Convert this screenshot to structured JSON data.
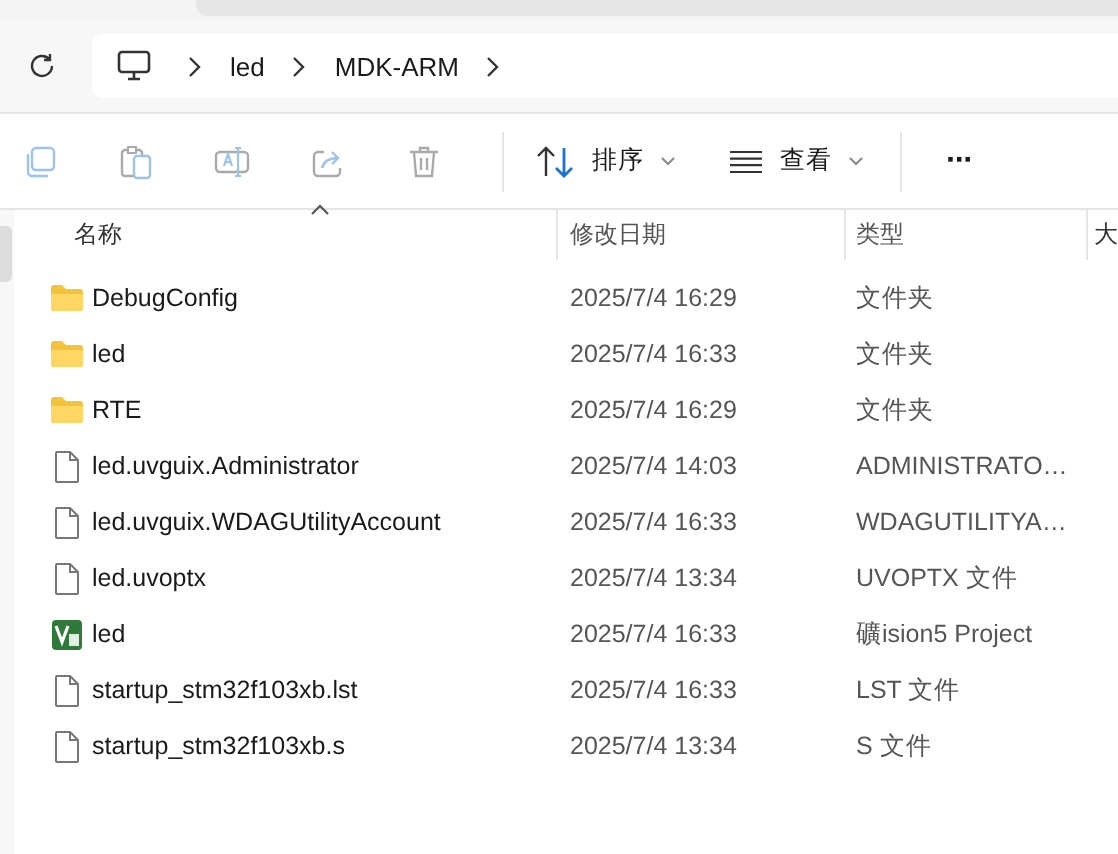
{
  "address_bar": {
    "segments": [
      {
        "kind": "computer"
      },
      {
        "kind": "text",
        "label": "led"
      },
      {
        "kind": "text",
        "label": "MDK-ARM"
      }
    ]
  },
  "toolbar": {
    "actions": [
      {
        "kind": "copy",
        "disabled": true
      },
      {
        "kind": "paste",
        "disabled": true
      },
      {
        "kind": "rename",
        "disabled": true
      },
      {
        "kind": "share",
        "disabled": true
      },
      {
        "kind": "delete",
        "disabled": true
      }
    ],
    "sort": {
      "label": "排序"
    },
    "view": {
      "label": "查看"
    },
    "more": {
      "label": "···"
    }
  },
  "table": {
    "columns": [
      {
        "label": "名称",
        "sorted": true
      },
      {
        "label": "修改日期",
        "sorted": false
      },
      {
        "label": "类型",
        "sorted": false
      },
      {
        "label": "大",
        "sorted": false
      }
    ],
    "rows": [
      {
        "kind": "folder",
        "name": "DebugConfig",
        "modified": "2025/7/4 16:29",
        "type": "文件夹"
      },
      {
        "kind": "folder",
        "name": "led",
        "modified": "2025/7/4 16:33",
        "type": "文件夹"
      },
      {
        "kind": "folder",
        "name": "RTE",
        "modified": "2025/7/4 16:29",
        "type": "文件夹"
      },
      {
        "kind": "file",
        "name": "led.uvguix.Administrator",
        "modified": "2025/7/4 14:03",
        "type": "ADMINISTRATO…"
      },
      {
        "kind": "file",
        "name": "led.uvguix.WDAGUtilityAccount",
        "modified": "2025/7/4 16:33",
        "type": "WDAGUTILITYA…"
      },
      {
        "kind": "file",
        "name": "led.uvoptx",
        "modified": "2025/7/4 13:34",
        "type": "UVOPTX 文件"
      },
      {
        "kind": "project",
        "name": "led",
        "modified": "2025/7/4 16:33",
        "type": "礦ision5 Project"
      },
      {
        "kind": "file",
        "name": "startup_stm32f103xb.lst",
        "modified": "2025/7/4 16:33",
        "type": "LST 文件"
      },
      {
        "kind": "file",
        "name": "startup_stm32f103xb.s",
        "modified": "2025/7/4 13:34",
        "type": "S 文件"
      }
    ]
  }
}
